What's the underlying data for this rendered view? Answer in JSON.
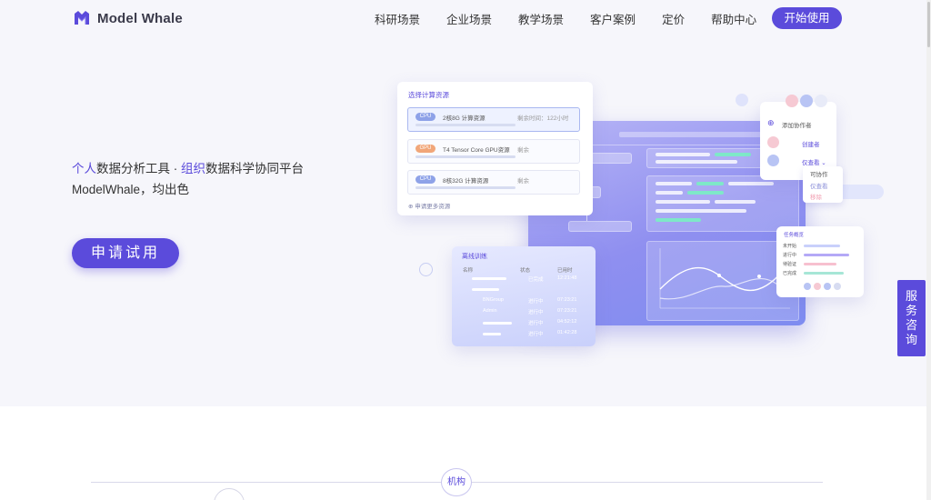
{
  "brand": {
    "name": "Model Whale",
    "accent": "#5b4bdb"
  },
  "nav": {
    "items": [
      "科研场景",
      "企业场景",
      "教学场景",
      "客户案例",
      "定价",
      "帮助中心"
    ],
    "cta": "开始使用"
  },
  "hero": {
    "tagline_a": "个人",
    "tagline_b": "数据分析工具 · ",
    "tagline_c": "组织",
    "tagline_d": "数据科学协同平台",
    "subline": "ModelWhale，均出色",
    "apply_label": "申请试用"
  },
  "illustration": {
    "resource_card": {
      "title": "选择计算资源",
      "rows": [
        {
          "chip": "CPU",
          "name": "2核8G 计算资源",
          "remain": "剩余时间：122小时"
        },
        {
          "chip": "GPU",
          "name": "T4 Tensor Core GPU资源",
          "remain": "剩余"
        },
        {
          "chip": "CPU",
          "name": "8核32G 计算资源",
          "remain": "剩余"
        }
      ],
      "more": "申请更多资源"
    },
    "training_card": {
      "title": "离线训练",
      "headers": [
        "名称",
        "状态",
        "已用时"
      ],
      "rows": [
        {
          "name": "",
          "status": "已完成",
          "time": "12:21:48"
        },
        {
          "name": "",
          "status": "",
          "time": ""
        },
        {
          "name": "BNGroup",
          "status": "进行中",
          "time": "07:23:21"
        },
        {
          "name": "Admin",
          "status": "进行中",
          "time": "07:23:21"
        },
        {
          "name": "",
          "status": "进行中",
          "time": "04:52:12"
        },
        {
          "name": "",
          "status": "进行中",
          "time": "01:42:28"
        }
      ]
    },
    "collab_card": {
      "add": "添加协作者",
      "creator": "创建者",
      "viewer": "仅查看",
      "perm_options": [
        "可协作",
        "仅查看",
        "移除"
      ]
    },
    "task_card": {
      "title": "任务概览",
      "labels": [
        "未开始",
        "进行中",
        "待验证",
        "已完成"
      ]
    }
  },
  "service": {
    "chars": [
      "服",
      "务",
      "咨",
      "询"
    ]
  },
  "section": {
    "org_label": "机构"
  }
}
